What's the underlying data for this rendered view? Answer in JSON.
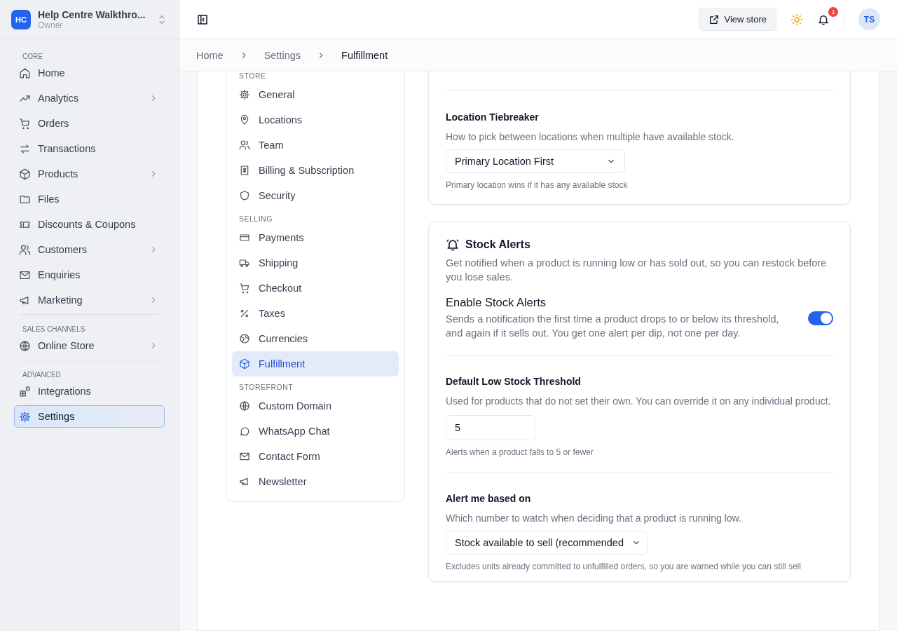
{
  "workspace": {
    "initials": "HC",
    "name": "Help Centre Walkthro...",
    "role": "Owner"
  },
  "sidebar": {
    "sections": [
      {
        "heading": "CORE",
        "items": [
          {
            "label": "Home",
            "expandable": false,
            "selected": false
          },
          {
            "label": "Analytics",
            "expandable": true,
            "selected": false
          },
          {
            "label": "Orders",
            "expandable": false,
            "selected": false
          },
          {
            "label": "Transactions",
            "expandable": false,
            "selected": false
          },
          {
            "label": "Products",
            "expandable": true,
            "selected": false
          },
          {
            "label": "Files",
            "expandable": false,
            "selected": false
          },
          {
            "label": "Discounts & Coupons",
            "expandable": false,
            "selected": false
          },
          {
            "label": "Customers",
            "expandable": true,
            "selected": false
          },
          {
            "label": "Enquiries",
            "expandable": false,
            "selected": false
          },
          {
            "label": "Marketing",
            "expandable": true,
            "selected": false
          }
        ]
      },
      {
        "heading": "SALES CHANNELS",
        "items": [
          {
            "label": "Online Store",
            "expandable": true,
            "selected": false
          }
        ]
      },
      {
        "heading": "ADVANCED",
        "items": [
          {
            "label": "Integrations",
            "expandable": false,
            "selected": false
          },
          {
            "label": "Settings",
            "expandable": false,
            "selected": true
          }
        ]
      }
    ]
  },
  "topbar": {
    "view_store": "View store",
    "notifications": "1",
    "avatar": "TS"
  },
  "breadcrumb": [
    "Home",
    "Settings",
    "Fulfillment"
  ],
  "settings_nav": [
    {
      "heading": "STORE",
      "items": [
        {
          "label": "General",
          "selected": false
        },
        {
          "label": "Locations",
          "selected": false
        },
        {
          "label": "Team",
          "selected": false
        },
        {
          "label": "Billing & Subscription",
          "selected": false
        },
        {
          "label": "Security",
          "selected": false
        }
      ]
    },
    {
      "heading": "SELLING",
      "items": [
        {
          "label": "Payments",
          "selected": false
        },
        {
          "label": "Shipping",
          "selected": false
        },
        {
          "label": "Checkout",
          "selected": false
        },
        {
          "label": "Taxes",
          "selected": false
        },
        {
          "label": "Currencies",
          "selected": false
        },
        {
          "label": "Fulfillment",
          "selected": true
        }
      ]
    },
    {
      "heading": "STOREFRONT",
      "items": [
        {
          "label": "Custom Domain",
          "selected": false
        },
        {
          "label": "WhatsApp Chat",
          "selected": false
        },
        {
          "label": "Contact Form",
          "selected": false
        },
        {
          "label": "Newsletter",
          "selected": false
        }
      ]
    }
  ],
  "tiebreaker": {
    "label": "Location Tiebreaker",
    "description": "How to pick between locations when multiple have available stock.",
    "value": "Primary Location First",
    "hint": "Primary location wins if it has any available stock"
  },
  "stock_alerts": {
    "title": "Stock Alerts",
    "description": "Get notified when a product is running low or has sold out, so you can restock before you lose sales.",
    "enable": {
      "label": "Enable Stock Alerts",
      "description": "Sends a notification the first time a product drops to or below its threshold, and again if it sells out. You get one alert per dip, not one per day.",
      "on": true
    },
    "threshold": {
      "label": "Default Low Stock Threshold",
      "description": "Used for products that do not set their own. You can override it on any individual product.",
      "value": "5",
      "hint": "Alerts when a product falls to 5 or fewer"
    },
    "basis": {
      "label": "Alert me based on",
      "description": "Which number to watch when deciding that a product is running low.",
      "value": "Stock available to sell (recommended",
      "hint": "Excludes units already committed to unfulfilled orders, so you are warned while you can still sell"
    }
  }
}
